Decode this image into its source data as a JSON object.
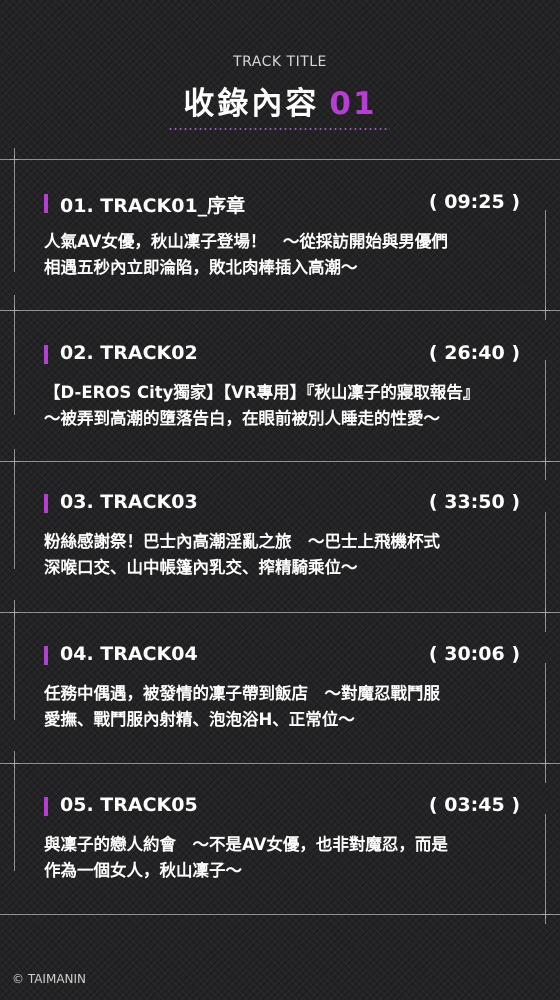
{
  "header": {
    "subtitle": "TRACK TITLE",
    "title": "收錄內容",
    "number": "01"
  },
  "tracks": [
    {
      "name": "01.  TRACK01_序章",
      "duration": "( 09:25 )",
      "line1": "人氣AV女優，秋山凜子登場！　～從採訪開始與男優們",
      "line2": "相遇五秒內立即淪陷，敗北肉棒插入高潮～"
    },
    {
      "name": "02.  TRACK02",
      "duration": "( 26:40 )",
      "line1": "【D-EROS City獨家】【VR專用】『秋山凜子的寢取報告』",
      "line2": "～被弄到高潮的墮落告白，在眼前被別人睡走的性愛～"
    },
    {
      "name": "03.  TRACK03",
      "duration": "( 33:50 )",
      "line1": "粉絲感謝祭！巴士內高潮淫亂之旅　～巴士上飛機杯式",
      "line2": "深喉口交、山中帳篷內乳交、搾精騎乘位～"
    },
    {
      "name": "04.  TRACK04",
      "duration": "( 30:06 )",
      "line1": "任務中偶遇，被發情的凜子帶到飯店　～對魔忍戰鬥服",
      "line2": "愛撫、戰鬥服內射精、泡泡浴H、正常位～"
    },
    {
      "name": "05.  TRACK05",
      "duration": "( 03:45 )",
      "line1": "與凜子的戀人約會　～不是AV女優，也非對魔忍，而是",
      "line2": "作為一個女人，秋山凜子～"
    }
  ],
  "footer": {
    "copyright": "© TAIMANIN"
  },
  "colors": {
    "accent": "#b43fd0",
    "background": "#232325",
    "text": "#ffffff",
    "line": "#8f8f94"
  }
}
